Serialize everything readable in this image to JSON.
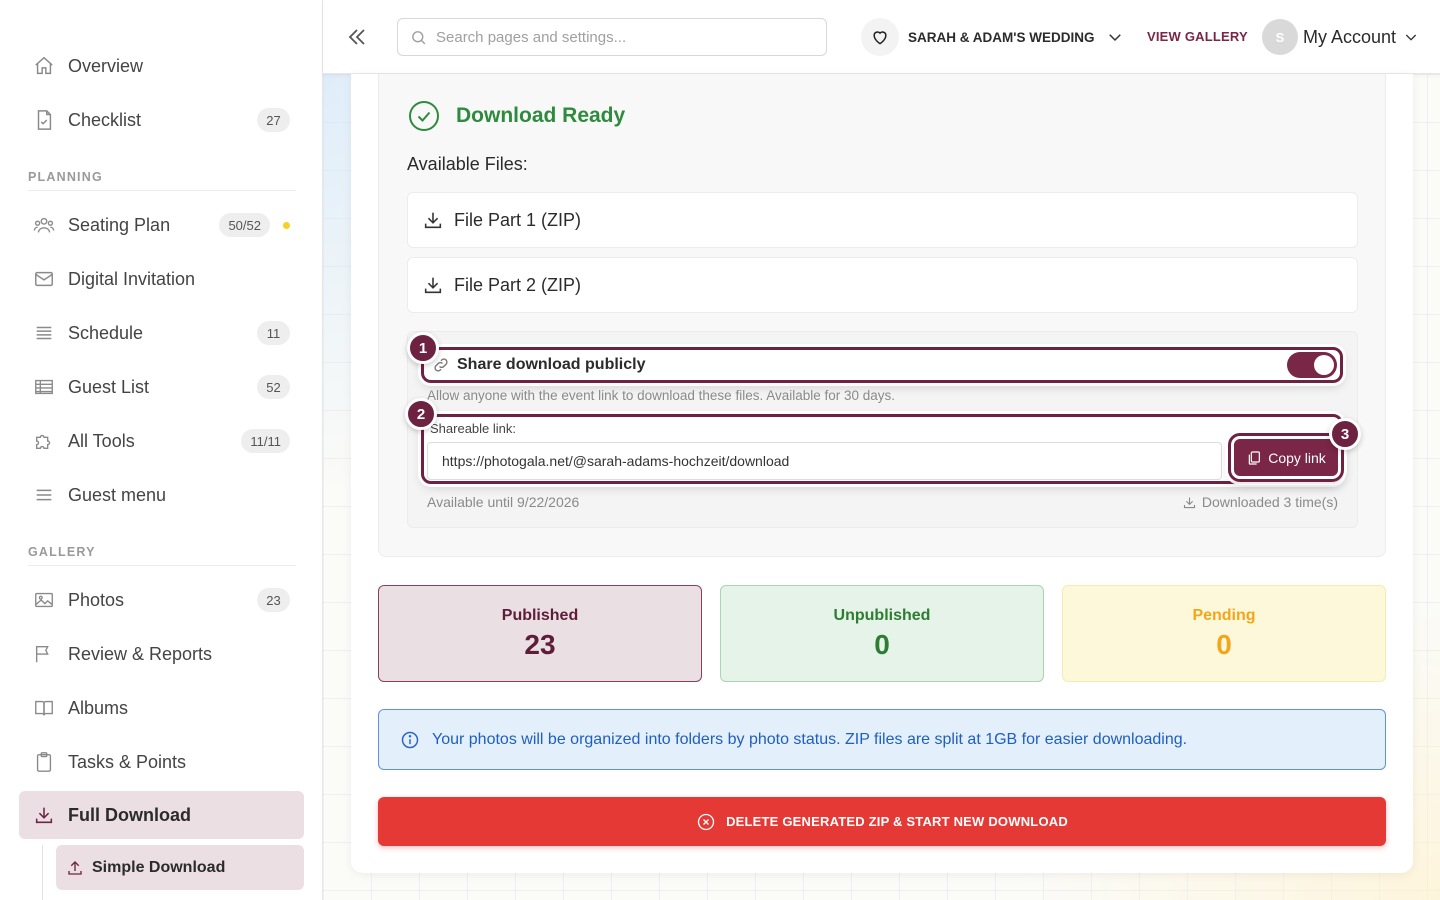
{
  "sidebar": {
    "items": [
      {
        "label": "Overview"
      },
      {
        "label": "Checklist",
        "badge": "27"
      },
      {
        "label": "Seating Plan",
        "badge": "50/52"
      },
      {
        "label": "Digital Invitation"
      },
      {
        "label": "Schedule",
        "badge": "11"
      },
      {
        "label": "Guest List",
        "badge": "52"
      },
      {
        "label": "All Tools",
        "badge": "11/11"
      },
      {
        "label": "Guest menu"
      },
      {
        "label": "Photos",
        "badge": "23"
      },
      {
        "label": "Review & Reports"
      },
      {
        "label": "Albums"
      },
      {
        "label": "Tasks & Points"
      },
      {
        "label": "Full Download"
      }
    ],
    "sections": {
      "planning": "PLANNING",
      "gallery": "GALLERY"
    },
    "sub_item": "Simple Download",
    "dot_color": "#f3d224"
  },
  "header": {
    "search_placeholder": "Search pages and settings...",
    "event_name": "SARAH & ADAM'S WEDDING",
    "view_gallery": "VIEW GALLERY",
    "avatar_initial": "S",
    "account": "My Account"
  },
  "download": {
    "status_title": "Download Ready",
    "files_title": "Available Files:",
    "files": [
      "File Part 1 (ZIP)",
      "File Part 2 (ZIP)"
    ],
    "share_label": "Share download publicly",
    "share_enabled": true,
    "share_description": "Allow anyone with the event link to download these files. Available for 30 days.",
    "link_label": "Shareable link:",
    "link_value": "https://photogala.net/@sarah-adams-hochzeit/download",
    "copy_label": "Copy link",
    "available_until": "Available until 9/22/2026",
    "downloaded": "Downloaded 3 time(s)",
    "steps": [
      "1",
      "2",
      "3"
    ]
  },
  "stats": {
    "published": {
      "label": "Published",
      "value": "23"
    },
    "unpublished": {
      "label": "Unpublished",
      "value": "0"
    },
    "pending": {
      "label": "Pending",
      "value": "0"
    }
  },
  "info_text": "Your photos will be organized into folders by photo status. ZIP files are split at 1GB for easier downloading.",
  "delete_label": "DELETE GENERATED ZIP & START NEW DOWNLOAD",
  "colors": {
    "brand": "#7a2646",
    "success": "#2e8b3e",
    "danger": "#e53935",
    "info": "#1f5fbf",
    "pending": "#f2a61d"
  }
}
